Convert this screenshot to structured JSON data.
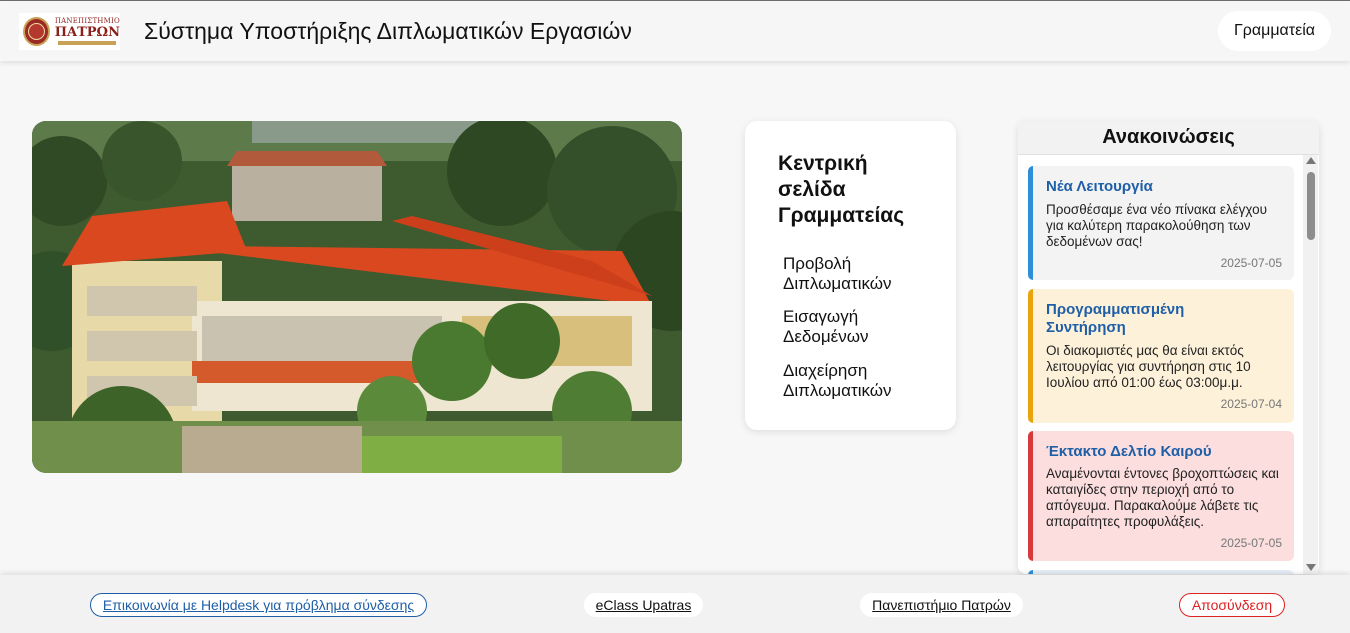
{
  "header": {
    "logo_line1": "ΠΑΝΕΠΙΣΤΗΜΙΟ",
    "logo_line2": "ΠΑΤΡΩΝ",
    "title": "Σύστημα Υποστήριξης Διπλωματικών Εργασιών",
    "role_button": "Γραμματεία"
  },
  "menu": {
    "title": "Κεντρική σελίδα Γραμματείας",
    "items": [
      {
        "label": "Προβολή Διπλωματικών"
      },
      {
        "label": "Εισαγωγή Δεδομένων"
      },
      {
        "label": "Διαχείρηση Διπλωματικών"
      }
    ]
  },
  "announcements": {
    "title": "Ανακοινώσεις",
    "items": [
      {
        "title": "Νέα Λειτουργία",
        "body": "Προσθέσαμε ένα νέο πίνακα ελέγχου για καλύτερη παρακολούθηση των δεδομένων σας!",
        "date": "2025-07-05",
        "accent": "#2d8fd8",
        "bg": "#f3f3f3"
      },
      {
        "title": "Προγραμματισμένη Συντήρηση",
        "body": "Οι διακομιστές μας θα είναι εκτός λειτουργίας για συντήρηση στις 10 Ιουλίου από 01:00 έως 03:00μ.μ.",
        "date": "2025-07-04",
        "accent": "#e9a30c",
        "bg": "#fdf1da"
      },
      {
        "title": "Έκτακτο Δελτίο Καιρού",
        "body": "Αναμένονται έντονες βροχοπτώσεις και καταιγίδες στην περιοχή από το απόγευμα. Παρακαλούμε λάβετε τις απαραίτητες προφυλάξεις.",
        "date": "2025-07-05",
        "accent": "#d63a3a",
        "bg": "#fbdedd"
      }
    ]
  },
  "footer": {
    "helpdesk": "Επικοινωνία με Helpdesk για πρόβλημα σύνδεσης",
    "eclass": "eClass Upatras",
    "university": "Πανεπιστήμιο Πατρών",
    "logout": "Αποσύνδεση"
  }
}
